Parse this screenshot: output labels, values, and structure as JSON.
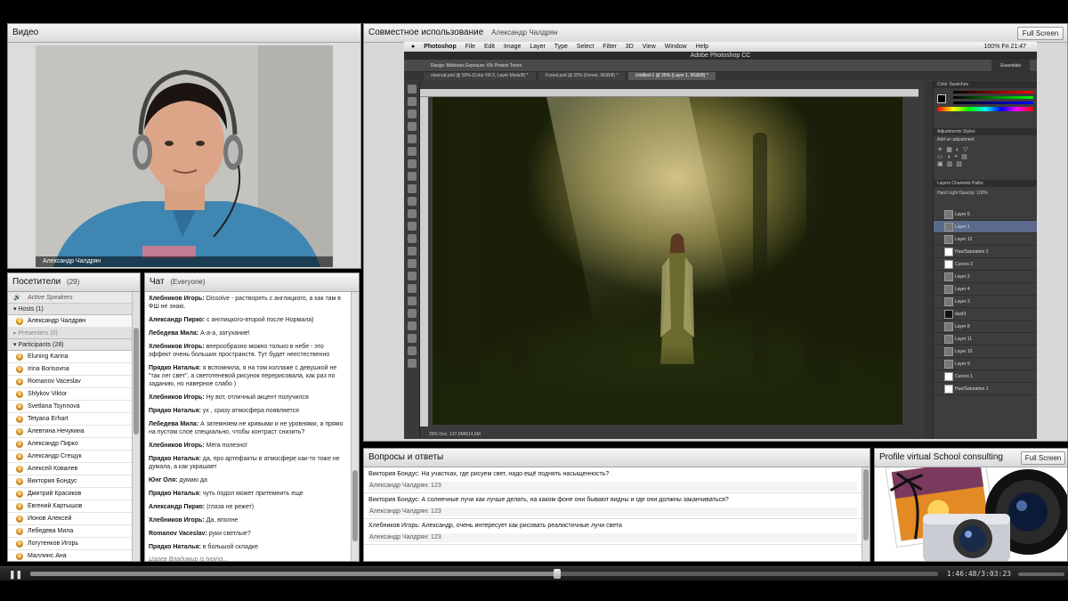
{
  "video": {
    "title": "Видео",
    "speaker_name": "Александр Чалдрян"
  },
  "share": {
    "title": "Совместное использование",
    "presenter": "Александр Чалдрян",
    "fullscreen_label": "Full Screen",
    "mac_menu": [
      "Photoshop",
      "File",
      "Edit",
      "Image",
      "Layer",
      "Type",
      "Select",
      "Filter",
      "3D",
      "View",
      "Window",
      "Help"
    ],
    "mac_status": "100%  Fri 21:47",
    "ps_title": "Adobe Photoshop CC",
    "ps_options": "Range: Midtones   Exposure: 6%   Protect Tones",
    "ps_workspace": "Essentials",
    "ps_tabs": [
      "clearcat.psd @ 50% (Color Fill 3, Layer Mask/8) *",
      "Forest.psd @ 25% (Forest, RGB/8) *",
      "Untitled-1 @ 25% (Layer 1, RGB/8) *"
    ],
    "ps_status": "25%   Doc: 137,9M/614,6M",
    "panel_color": "Color  Swatches",
    "panel_adjust": "Adjustments  Styles",
    "panel_adjust_add": "Add an adjustment",
    "panel_layers": "Layers  Channels  Paths",
    "layer_mode": "Hard Light  Opacity: 100%",
    "layers": [
      "Layer 6",
      "Layer 1",
      "Layer 12",
      "Hue/Saturation 2",
      "Curves 2",
      "Layer 2",
      "Layer 4",
      "Layer 3",
      "dust3",
      "Layer 8",
      "Layer 11",
      "Layer 10",
      "Layer 9",
      "Curves 1",
      "Hue/Saturation 1"
    ]
  },
  "attendees": {
    "title": "Посетители",
    "count": "(29)",
    "active_speakers": "Active Speakers",
    "hosts_label": "Hosts (1)",
    "hosts": [
      "Александр Чалдрян"
    ],
    "presenters_label": "Presenters (0)",
    "participants_label": "Participants (28)",
    "participants": [
      "Eluning Karina",
      "Irina Borisovna",
      "Romanov Vaceslav",
      "Shlykov Viktor",
      "Svetlana Tsynnova",
      "Tetyana Erhart",
      "Алевтина Нечукина",
      "Александр Пирко",
      "Александр Сгещук",
      "Алексей Ковалев",
      "Виктория Бондус",
      "Дмитрий Красиков",
      "Евгений Картышов",
      "Ионов Алексей",
      "Лебедева Мила",
      "Логутенков Игорь",
      "Маллинс Ана"
    ]
  },
  "chat": {
    "title": "Чат",
    "scope": "(Everyone)",
    "messages": [
      {
        "author": "Хлебников Игорь:",
        "text": "Dissolve - растворять с англицкого, а как там в ФШ не знаю."
      },
      {
        "author": "Александр Пирко:",
        "text": "с англицкого-второй после Нормала)"
      },
      {
        "author": "Лебедева Мила:",
        "text": "А-а-а, затухание!"
      },
      {
        "author": "Хлебников Игорь:",
        "text": "веерообразно можно только в небе - это эффект очень больших пространств. Тут будет неестественно"
      },
      {
        "author": "Прядко Наталья:",
        "text": "я вспомнила, я на том коллаже с девушкой не \"так лег свет\", а светотеневой рисунок перерисовала, как раз по заданию, но наверное слабо )"
      },
      {
        "author": "Хлебников Игорь:",
        "text": "Ну вот, отличный акцент получился"
      },
      {
        "author": "Прядко Наталья:",
        "text": "ух , сразу атмосфера появляется"
      },
      {
        "author": "Лебедева Мила:",
        "text": "А затемняем не кривыми и не уровнями, а прямо на пустом слое специально, чтобы контраст снизить?"
      },
      {
        "author": "Хлебников Игорь:",
        "text": "Мега полезно!"
      },
      {
        "author": "Прядко Наталья:",
        "text": "да, про артефакты в атмосфере как-то тоже не думала, а как украшает"
      },
      {
        "author": "Юнг Оля:",
        "text": "думаю да"
      },
      {
        "author": "Прядко Наталья:",
        "text": "чуть подол может притемнить еще"
      },
      {
        "author": "Александр Пирко:",
        "text": "(глаза не режет)"
      },
      {
        "author": "Хлебников Игорь:",
        "text": "Да, вполне"
      },
      {
        "author": "Romanov Vaceslav:",
        "text": "руки светлые?"
      },
      {
        "author": "Прядко Наталья:",
        "text": "в большой складке"
      }
    ],
    "typing": "Царев Владимир is typing..."
  },
  "qa": {
    "title": "Вопросы и ответы",
    "items": [
      {
        "q": "Виктория Бондус: На участках, где рисуем свет, надо ещё поднять насыщенность?",
        "a": "Александр Чалдрян: 123"
      },
      {
        "q": "Виктория Бондус: А солнечные лучи как лучше делать, на каком фоне они бывают видны  и где они должны заканчиваться?",
        "a": "Александр Чалдрян: 123"
      },
      {
        "q": "Хлебников Игорь: Александр, очень интересует как рисовать реалистичные лучи света",
        "a": "Александр Чалдрян: 123"
      }
    ]
  },
  "profile": {
    "title": "Profile virtual School consulting",
    "fullscreen_label": "Full Screen"
  },
  "player": {
    "time": "1:46:48/3:03:23",
    "progress": 0.58
  },
  "colors": {
    "pod_bg": "#f1f1f1",
    "selection": "#5b6a8a",
    "host_icon": "#f6c770"
  }
}
